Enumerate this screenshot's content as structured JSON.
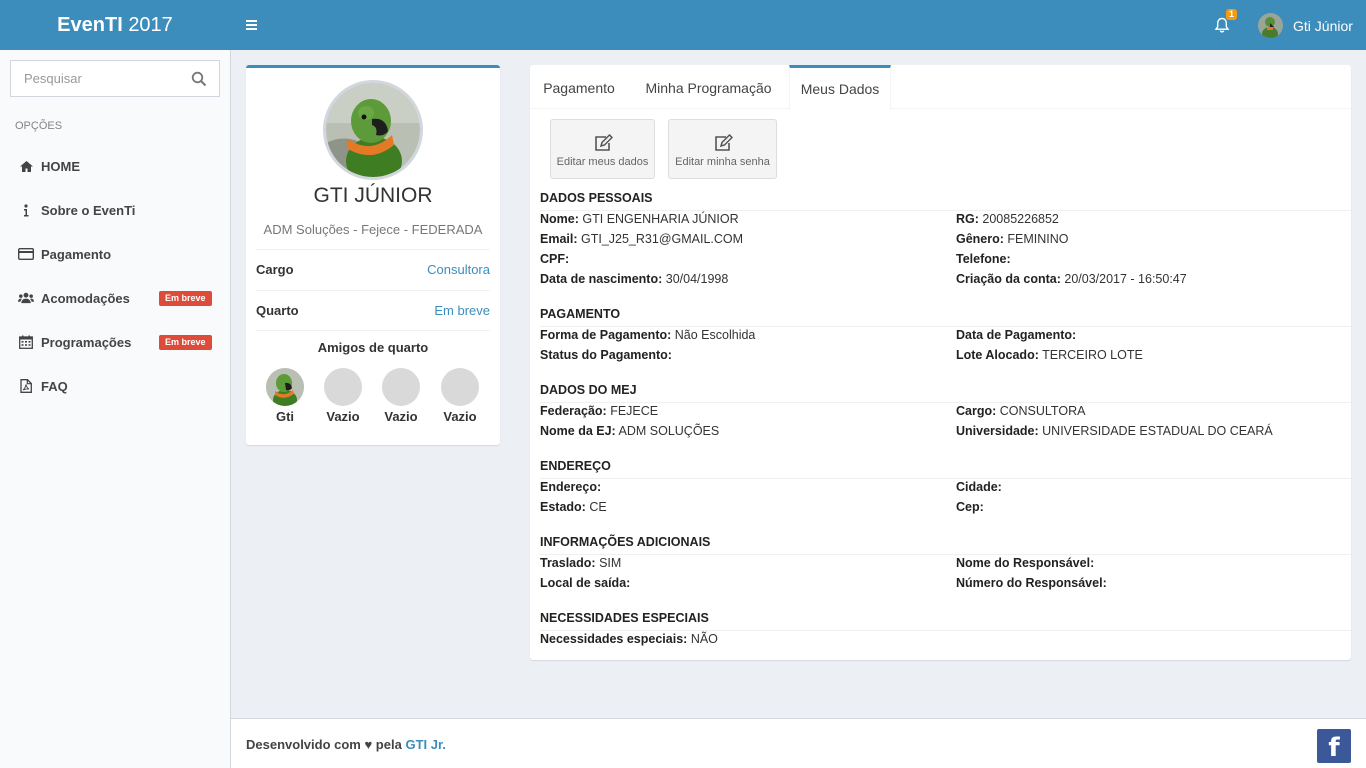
{
  "header": {
    "logo_bold": "EvenTI",
    "logo_year": "2017",
    "notif_count": "1",
    "user_name": "Gti Júnior"
  },
  "sidebar": {
    "search_placeholder": "Pesquisar",
    "section_label": "OPÇÕES",
    "items": [
      {
        "label": "HOME",
        "icon": "home-icon"
      },
      {
        "label": "Sobre o EvenTi",
        "icon": "info-icon"
      },
      {
        "label": "Pagamento",
        "icon": "credit-card-icon"
      },
      {
        "label": "Acomodações",
        "icon": "users-icon",
        "badge": "Em breve"
      },
      {
        "label": "Programações",
        "icon": "calendar-icon",
        "badge": "Em breve"
      },
      {
        "label": "FAQ",
        "icon": "pdf-file-icon"
      }
    ]
  },
  "profile": {
    "name": "GTI JÚNIOR",
    "subtitle": "ADM Soluções - Fejece - FEDERADA",
    "cargo_label": "Cargo",
    "cargo_value": "Consultora",
    "quarto_label": "Quarto",
    "quarto_value": "Em breve",
    "friends_title": "Amigos de quarto",
    "friends": [
      "Gti",
      "Vazio",
      "Vazio",
      "Vazio"
    ]
  },
  "tabs": [
    "Pagamento",
    "Minha Programação",
    "Meus Dados"
  ],
  "actions": {
    "edit_data": "Editar meus dados",
    "edit_password": "Editar minha senha"
  },
  "sections": {
    "pessoais": {
      "title": "DADOS PESSOAIS",
      "nome_l": "Nome:",
      "nome_v": "GTI ENGENHARIA JÚNIOR",
      "rg_l": "RG:",
      "rg_v": "20085226852",
      "email_l": "Email:",
      "email_v": "GTI_J25_R31@GMAIL.COM",
      "genero_l": "Gênero:",
      "genero_v": "FEMININO",
      "cpf_l": "CPF:",
      "cpf_v": "",
      "tel_l": "Telefone:",
      "tel_v": "",
      "nasc_l": "Data de nascimento:",
      "nasc_v": "30/04/1998",
      "criacao_l": "Criação da conta:",
      "criacao_v": "20/03/2017 - 16:50:47"
    },
    "pagamento": {
      "title": "PAGAMENTO",
      "forma_l": "Forma de Pagamento:",
      "forma_v": "Não Escolhida",
      "data_l": "Data de Pagamento:",
      "data_v": "",
      "status_l": "Status do Pagamento:",
      "status_v": "",
      "lote_l": "Lote Alocado:",
      "lote_v": "TERCEIRO LOTE"
    },
    "mej": {
      "title": "DADOS DO MEJ",
      "fed_l": "Federação:",
      "fed_v": "FEJECE",
      "cargo_l": "Cargo:",
      "cargo_v": "CONSULTORA",
      "ej_l": "Nome da EJ:",
      "ej_v": "ADM SOLUÇÕES",
      "univ_l": "Universidade:",
      "univ_v": "UNIVERSIDADE ESTADUAL DO CEARÁ"
    },
    "endereco": {
      "title": "ENDEREÇO",
      "end_l": "Endereço:",
      "end_v": "",
      "cidade_l": "Cidade:",
      "cidade_v": "",
      "estado_l": "Estado:",
      "estado_v": "CE",
      "cep_l": "Cep:",
      "cep_v": ""
    },
    "adicionais": {
      "title": "INFORMAÇÕES ADICIONAIS",
      "traslado_l": "Traslado:",
      "traslado_v": "SIM",
      "resp_l": "Nome do Responsável:",
      "resp_v": "",
      "local_l": "Local de saída:",
      "local_v": "",
      "num_l": "Número do Responsável:",
      "num_v": ""
    },
    "especiais": {
      "title": "NECESSIDADES ESPECIAIS",
      "nec_l": "Necessidades especiais:",
      "nec_v": "NÃO"
    }
  },
  "footer": {
    "text": "Desenvolvido com ♥ pela",
    "link": "GTI Jr.",
    "facebook": "f"
  },
  "colors": {
    "primary": "#3c8dbc",
    "danger": "#dd4b39",
    "warning": "#f39c12",
    "facebook": "#3b5998"
  }
}
